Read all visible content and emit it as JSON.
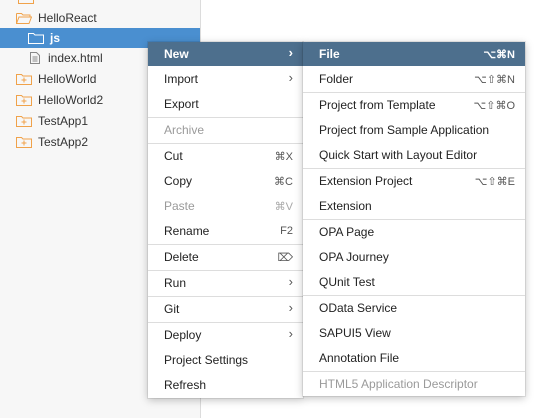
{
  "tree": {
    "items": [
      {
        "label": "HelloReact"
      },
      {
        "label": "js"
      },
      {
        "label": "index.html"
      },
      {
        "label": "HelloWorld"
      },
      {
        "label": "HelloWorld2"
      },
      {
        "label": "TestApp1"
      },
      {
        "label": "TestApp2"
      }
    ]
  },
  "context_menu": {
    "new": {
      "label": "New"
    },
    "import": {
      "label": "Import"
    },
    "export": {
      "label": "Export"
    },
    "archive": {
      "label": "Archive"
    },
    "cut": {
      "label": "Cut",
      "shortcut": "⌘X"
    },
    "copy": {
      "label": "Copy",
      "shortcut": "⌘C"
    },
    "paste": {
      "label": "Paste",
      "shortcut": "⌘V"
    },
    "rename": {
      "label": "Rename",
      "shortcut": "F2"
    },
    "delete": {
      "label": "Delete",
      "shortcut": "⌦"
    },
    "run": {
      "label": "Run"
    },
    "git": {
      "label": "Git"
    },
    "deploy": {
      "label": "Deploy"
    },
    "project_settings": {
      "label": "Project Settings"
    },
    "refresh": {
      "label": "Refresh"
    },
    "submenu_arrow": "›"
  },
  "new_submenu": {
    "file": {
      "label": "File",
      "shortcut": "⌥⌘N"
    },
    "folder": {
      "label": "Folder",
      "shortcut": "⌥⇧⌘N"
    },
    "project_from_template": {
      "label": "Project from Template",
      "shortcut": "⌥⇧⌘O"
    },
    "project_from_sample": {
      "label": "Project from Sample Application"
    },
    "quick_start": {
      "label": "Quick Start with Layout Editor"
    },
    "extension_project": {
      "label": "Extension Project",
      "shortcut": "⌥⇧⌘E"
    },
    "extension": {
      "label": "Extension"
    },
    "opa_page": {
      "label": "OPA Page"
    },
    "opa_journey": {
      "label": "OPA Journey"
    },
    "qunit_test": {
      "label": "QUnit Test"
    },
    "odata_service": {
      "label": "OData Service"
    },
    "sapui5_view": {
      "label": "SAPUI5 View"
    },
    "annotation_file": {
      "label": "Annotation File"
    },
    "html5_descriptor": {
      "label": "HTML5 Application Descriptor"
    }
  },
  "colors": {
    "selection": "#4a8fd0",
    "menu_highlight": "#4d6f8d",
    "folder_icon": "#f0a24a",
    "disabled_text": "#9a9a9a"
  },
  "icons": {
    "open_folder": "folder-open-icon",
    "folder": "folder-icon",
    "file": "file-icon",
    "project": "project-folder-icon"
  }
}
